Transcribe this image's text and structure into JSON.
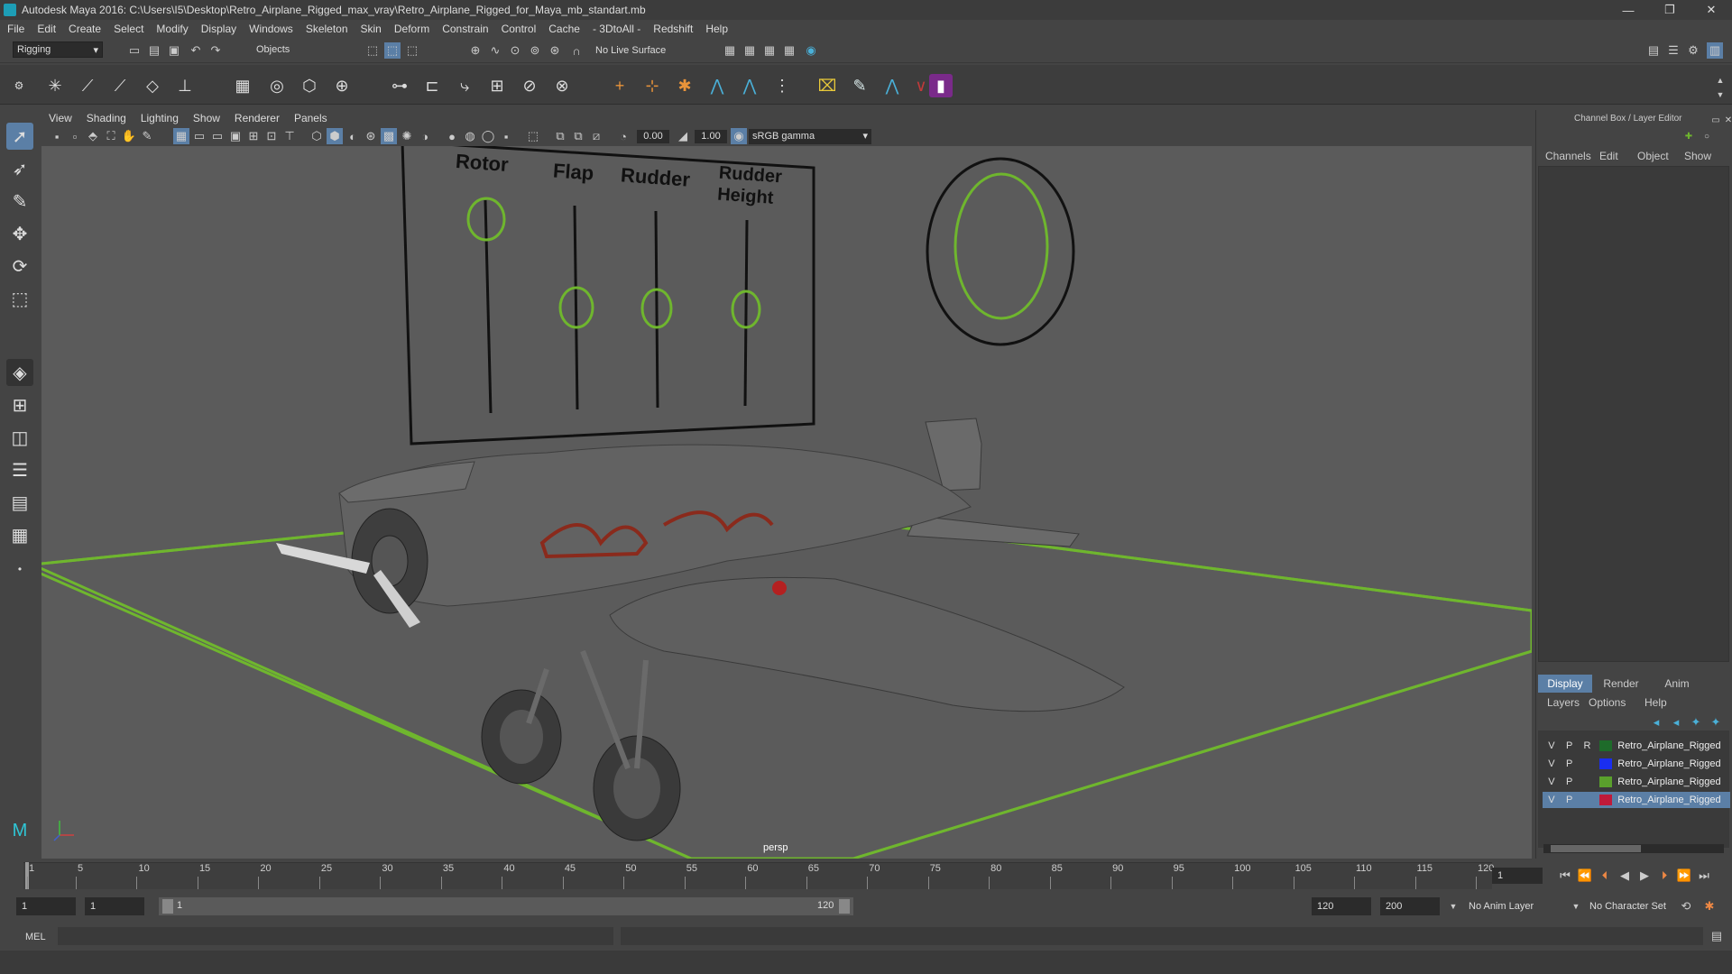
{
  "window": {
    "title": "Autodesk Maya 2016: C:\\Users\\I5\\Desktop\\Retro_Airplane_Rigged_max_vray\\Retro_Airplane_Rigged_for_Maya_mb_standart.mb"
  },
  "menubar": [
    "File",
    "Edit",
    "Create",
    "Select",
    "Modify",
    "Display",
    "Windows",
    "Skeleton",
    "Skin",
    "Deform",
    "Constrain",
    "Control",
    "Cache",
    "- 3DtoAll -",
    "Redshift",
    "Help"
  ],
  "statusline": {
    "menuset": "Rigging",
    "selection_mode": "Objects",
    "live_surface": "No Live Surface"
  },
  "viewport": {
    "menus": [
      "View",
      "Shading",
      "Lighting",
      "Show",
      "Renderer",
      "Panels"
    ],
    "exposure": "0.00",
    "gamma": "1.00",
    "color_space": "sRGB gamma",
    "camera_label": "persp",
    "controls": {
      "rotor": "Rotor",
      "flap": "Flap",
      "rudder": "Rudder",
      "rudder_height": "Rudder Height"
    }
  },
  "timeline": {
    "ticks": [
      "1",
      "5",
      "10",
      "15",
      "20",
      "25",
      "30",
      "35",
      "40",
      "45",
      "50",
      "55",
      "60",
      "65",
      "70",
      "75",
      "80",
      "85",
      "90",
      "95",
      "100",
      "105",
      "110",
      "115",
      "120"
    ],
    "current_frame": "1"
  },
  "range": {
    "start": "1",
    "playback_start": "1",
    "slider_start": "1",
    "slider_end": "120",
    "playback_end": "120",
    "end": "200",
    "anim_layer": "No Anim Layer",
    "character_set": "No Character Set"
  },
  "command": {
    "lang": "MEL"
  },
  "channelbox": {
    "header": "Channel Box / Layer Editor",
    "menus": [
      "Channels",
      "Edit",
      "Object",
      "Show"
    ],
    "tabs": [
      "Display",
      "Render",
      "Anim"
    ],
    "layer_menus": [
      "Layers",
      "Options",
      "Help"
    ],
    "layers": [
      {
        "v": "V",
        "p": "P",
        "r": "R",
        "color": "#1e6b2a",
        "name": "Retro_Airplane_Rigged"
      },
      {
        "v": "V",
        "p": "P",
        "r": "",
        "color": "#1a2ef0",
        "name": "Retro_Airplane_Rigged"
      },
      {
        "v": "V",
        "p": "P",
        "r": "",
        "color": "#5aa02c",
        "name": "Retro_Airplane_Rigged"
      },
      {
        "v": "V",
        "p": "P",
        "r": "",
        "color": "#c01a3a",
        "name": "Retro_Airplane_Rigged"
      }
    ]
  }
}
